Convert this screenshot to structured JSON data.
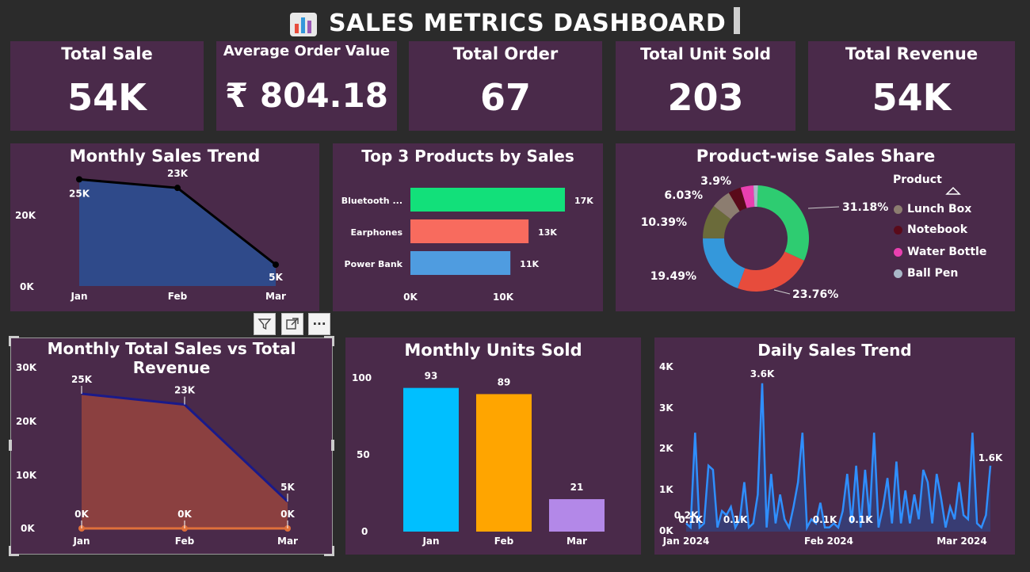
{
  "dashboard": {
    "title": "SALES METRICS DASHBOARD"
  },
  "kpis": [
    {
      "label": "Total Sale",
      "value": "54K"
    },
    {
      "label": "Average Order Value",
      "value": "₹ 804.18"
    },
    {
      "label": "Total Order",
      "value": "67"
    },
    {
      "label": "Total Unit Sold",
      "value": "203"
    },
    {
      "label": "Total Revenue",
      "value": "54K"
    }
  ],
  "visual_toolbar": {
    "filter_icon": "filter-icon",
    "focus_icon": "focus-mode-icon",
    "more_icon": "more-options-icon",
    "more_label": "···"
  },
  "colors": {
    "card": "#4a2a4a",
    "background": "#2b2b2b"
  },
  "chart_data": [
    {
      "id": "monthly-sales-trend",
      "type": "area",
      "title": "Monthly Sales Trend",
      "categories": [
        "Jan",
        "Feb",
        "Mar"
      ],
      "values": [
        25000,
        23000,
        5000
      ],
      "data_labels": [
        "25K",
        "23K",
        "5K"
      ],
      "yticks": [
        "0K",
        "20K"
      ],
      "ylim": [
        0,
        26000
      ],
      "fill": "#2f4a8a",
      "line": "#000000"
    },
    {
      "id": "top3-products",
      "type": "bar",
      "title": "Top 3 Products by Sales",
      "categories": [
        "Bluetooth ...",
        "Earphones",
        "Power Bank"
      ],
      "values": [
        17000,
        13000,
        11000
      ],
      "data_labels": [
        "17K",
        "13K",
        "11K"
      ],
      "xticks": [
        "0K",
        "10K"
      ],
      "xlim": [
        0,
        17000
      ],
      "colors": [
        "#12e07a",
        "#f86b5e",
        "#4f9ce0"
      ]
    },
    {
      "id": "product-share",
      "type": "pie",
      "title": "Product-wise Sales Share",
      "legend_title": "Product",
      "legend": [
        {
          "name": "Lunch Box",
          "color": "#8c7d70"
        },
        {
          "name": "Notebook",
          "color": "#5a0a1a"
        },
        {
          "name": "Water Bottle",
          "color": "#e940b0"
        },
        {
          "name": "Ball Pen",
          "color": "#a9b8c8"
        }
      ],
      "slices": [
        {
          "value": 31.18,
          "label": "31.18%",
          "color": "#2ecc71"
        },
        {
          "value": 23.76,
          "label": "23.76%",
          "color": "#e74c3c"
        },
        {
          "value": 19.49,
          "label": "19.49%",
          "color": "#3498db"
        },
        {
          "value": 10.39,
          "label": "10.39%",
          "color": "#6b6b3a"
        },
        {
          "value": 6.03,
          "label": "6.03%",
          "color": "#8c7d70"
        },
        {
          "value": 3.9,
          "label": "3.9%",
          "color": "#5a0a1a"
        },
        {
          "value": 3.9,
          "label": "",
          "color": "#e940b0"
        },
        {
          "value": 1.35,
          "label": "",
          "color": "#a9b8c8"
        }
      ]
    },
    {
      "id": "sales-vs-revenue",
      "type": "area",
      "title": "Monthly Total Sales vs Total Revenue",
      "categories": [
        "Jan",
        "Feb",
        "Mar"
      ],
      "series": [
        {
          "values": [
            25000,
            23000,
            5000
          ],
          "data_labels": [
            "25K",
            "23K",
            "5K"
          ],
          "color": "#8b4040",
          "line": "#1a1a8a"
        },
        {
          "values": [
            0,
            0,
            0
          ],
          "data_labels": [
            "0K",
            "0K",
            "0K"
          ],
          "color": "#e0703a",
          "line": "#e0703a"
        }
      ],
      "yticks": [
        "0K",
        "10K",
        "20K",
        "30K"
      ],
      "ylim": [
        0,
        30000
      ]
    },
    {
      "id": "monthly-units",
      "type": "bar",
      "title": "Monthly Units Sold",
      "categories": [
        "Jan",
        "Feb",
        "Mar"
      ],
      "values": [
        93,
        89,
        21
      ],
      "data_labels": [
        "93",
        "89",
        "21"
      ],
      "yticks": [
        "0",
        "50",
        "100"
      ],
      "ylim": [
        0,
        100
      ],
      "colors": [
        "#00bfff",
        "#ffa500",
        "#b388e8"
      ]
    },
    {
      "id": "daily-sales",
      "type": "line",
      "title": "Daily Sales Trend",
      "xticks": [
        "Jan 2024",
        "Feb 2024",
        "Mar 2024"
      ],
      "yticks": [
        "0K",
        "1K",
        "2K",
        "3K",
        "4K"
      ],
      "ylim": [
        0,
        4000
      ],
      "values": [
        200,
        100,
        2400,
        100,
        200,
        1600,
        1500,
        100,
        500,
        400,
        600,
        100,
        300,
        1200,
        100,
        200,
        900,
        3600,
        100,
        1400,
        200,
        900,
        300,
        100,
        600,
        1200,
        2400,
        100,
        300,
        200,
        700,
        100,
        100,
        200,
        100,
        500,
        1400,
        200,
        1600,
        100,
        1500,
        300,
        2400,
        100,
        600,
        1300,
        200,
        1700,
        200,
        1000,
        200,
        900,
        300,
        1500,
        1200,
        200,
        1400,
        800,
        100,
        600,
        300,
        1200,
        400,
        300,
        2400,
        200,
        100,
        400,
        1600
      ],
      "data_labels": [
        {
          "index": 0,
          "label": "0.2K"
        },
        {
          "index": 1,
          "label": "0.1K"
        },
        {
          "index": 11,
          "label": "0.1K"
        },
        {
          "index": 17,
          "label": "3.6K"
        },
        {
          "index": 31,
          "label": "0.1K"
        },
        {
          "index": 39,
          "label": "0.1K"
        },
        {
          "index": 68,
          "label": "1.6K"
        }
      ],
      "line": "#2f8fff"
    }
  ]
}
